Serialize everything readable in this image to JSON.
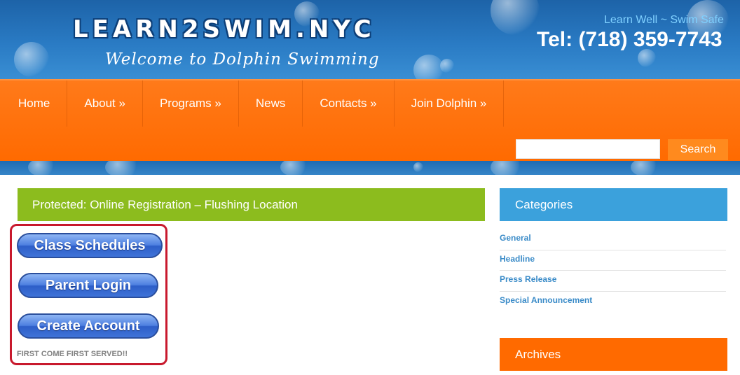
{
  "header": {
    "logo": "LEARN2SWIM.NYC",
    "tagline": "Welcome to Dolphin Swimming",
    "slogan": "Learn Well ~ Swim Safe",
    "phone": "Tel: (718) 359-7743"
  },
  "nav": {
    "items": [
      {
        "label": "Home"
      },
      {
        "label": "About »"
      },
      {
        "label": "Programs »"
      },
      {
        "label": "News"
      },
      {
        "label": "Contacts »"
      },
      {
        "label": "Join Dolphin »"
      }
    ],
    "search": {
      "value": "",
      "button_label": "Search"
    }
  },
  "main": {
    "post_title": "Protected: Online Registration –  Flushing Location",
    "buttons": {
      "class_schedules": "Class Schedules",
      "parent_login": "Parent Login",
      "create_account": "Create Account"
    },
    "note": "FIRST COME FIRST SERVED!!"
  },
  "sidebar": {
    "categories_title": "Categories",
    "categories": [
      "General",
      "Headline",
      "Press Release",
      "Special Announcement"
    ],
    "archives_title": "Archives"
  },
  "colors": {
    "header_blue": "#2a7bc4",
    "nav_orange": "#ff6a00",
    "title_green": "#8cbc1e",
    "sidebar_blue": "#3ba1dc",
    "highlight_red": "#c8192d"
  }
}
